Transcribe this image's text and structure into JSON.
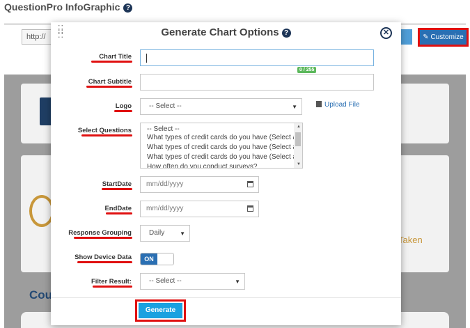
{
  "background": {
    "app_title": "QuestionPro InfoGraphic",
    "url_field_value": "http://",
    "customize_label": "Customize",
    "taken_text": "Taken",
    "section_title_partial": "Cou"
  },
  "modal": {
    "title": "Generate Chart Options",
    "close_icon": "close-icon",
    "help_icon": "help-icon",
    "drag_icon": "drag-handle-icon",
    "fields": {
      "chart_title": {
        "label": "Chart Title",
        "value": "",
        "char_count": "0 / 255"
      },
      "chart_subtitle": {
        "label": "Chart Subtitle",
        "value": ""
      },
      "logo": {
        "label": "Logo",
        "selected": "-- Select --",
        "upload_label": "Upload File"
      },
      "select_questions": {
        "label": "Select Questions",
        "options": [
          "-- Select --",
          "What types of credit cards do you have (Select all",
          "What types of credit cards do you have (Select all",
          "What types of credit cards do you have (Select all",
          "How often do you conduct surveys?"
        ]
      },
      "start_date": {
        "label": "StartDate",
        "placeholder": "mm/dd/yyyy"
      },
      "end_date": {
        "label": "EndDate",
        "placeholder": "mm/dd/yyyy"
      },
      "response_grouping": {
        "label": "Response Grouping",
        "selected": "Daily"
      },
      "show_device_data": {
        "label": "Show Device Data",
        "toggle_label": "ON",
        "on": true
      },
      "filter_result": {
        "label": "Filter Result:",
        "selected": "-- Select --"
      }
    },
    "generate_label": "Generate"
  },
  "colors": {
    "annotation_red": "#e01010",
    "primary_blue": "#2a6fb3",
    "generate_blue": "#1aa1e0",
    "count_badge_green": "#5cb85c"
  }
}
